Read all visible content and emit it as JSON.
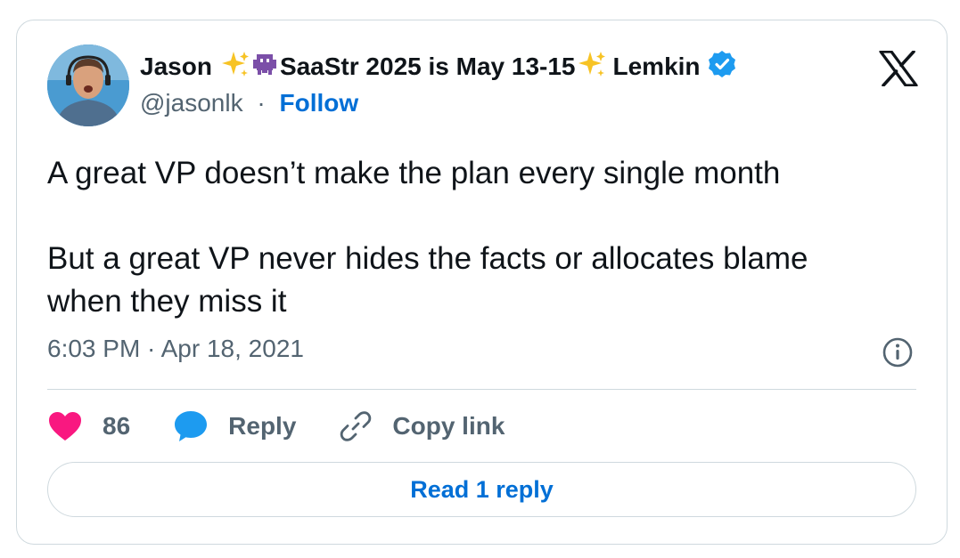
{
  "author": {
    "name_part1": "Jason",
    "name_part2": "SaaStr 2025 is May 13-15",
    "name_part3": "Lemkin",
    "handle": "@jasonlk",
    "separator": "·",
    "follow_label": "Follow",
    "verified": true
  },
  "tweet": {
    "line1": "A great VP doesn’t make the plan every single month",
    "line2": "But a great VP never hides the facts or allocates blame when they miss it",
    "timestamp": "6:03 PM · Apr 18, 2021"
  },
  "actions": {
    "likes_count": "86",
    "reply_label": "Reply",
    "copy_link_label": "Copy link",
    "read_replies_label": "Read 1 reply"
  },
  "colors": {
    "accent": "#006fd6",
    "verified": "#1d9bf0",
    "heart": "#f91880",
    "muted": "#536471",
    "border": "#cfd9de"
  },
  "icons": [
    "avatar",
    "sparkles-icon",
    "alien-monster-icon",
    "verified-badge-icon",
    "x-logo-icon",
    "info-icon",
    "heart-icon",
    "reply-bubble-icon",
    "link-icon"
  ]
}
